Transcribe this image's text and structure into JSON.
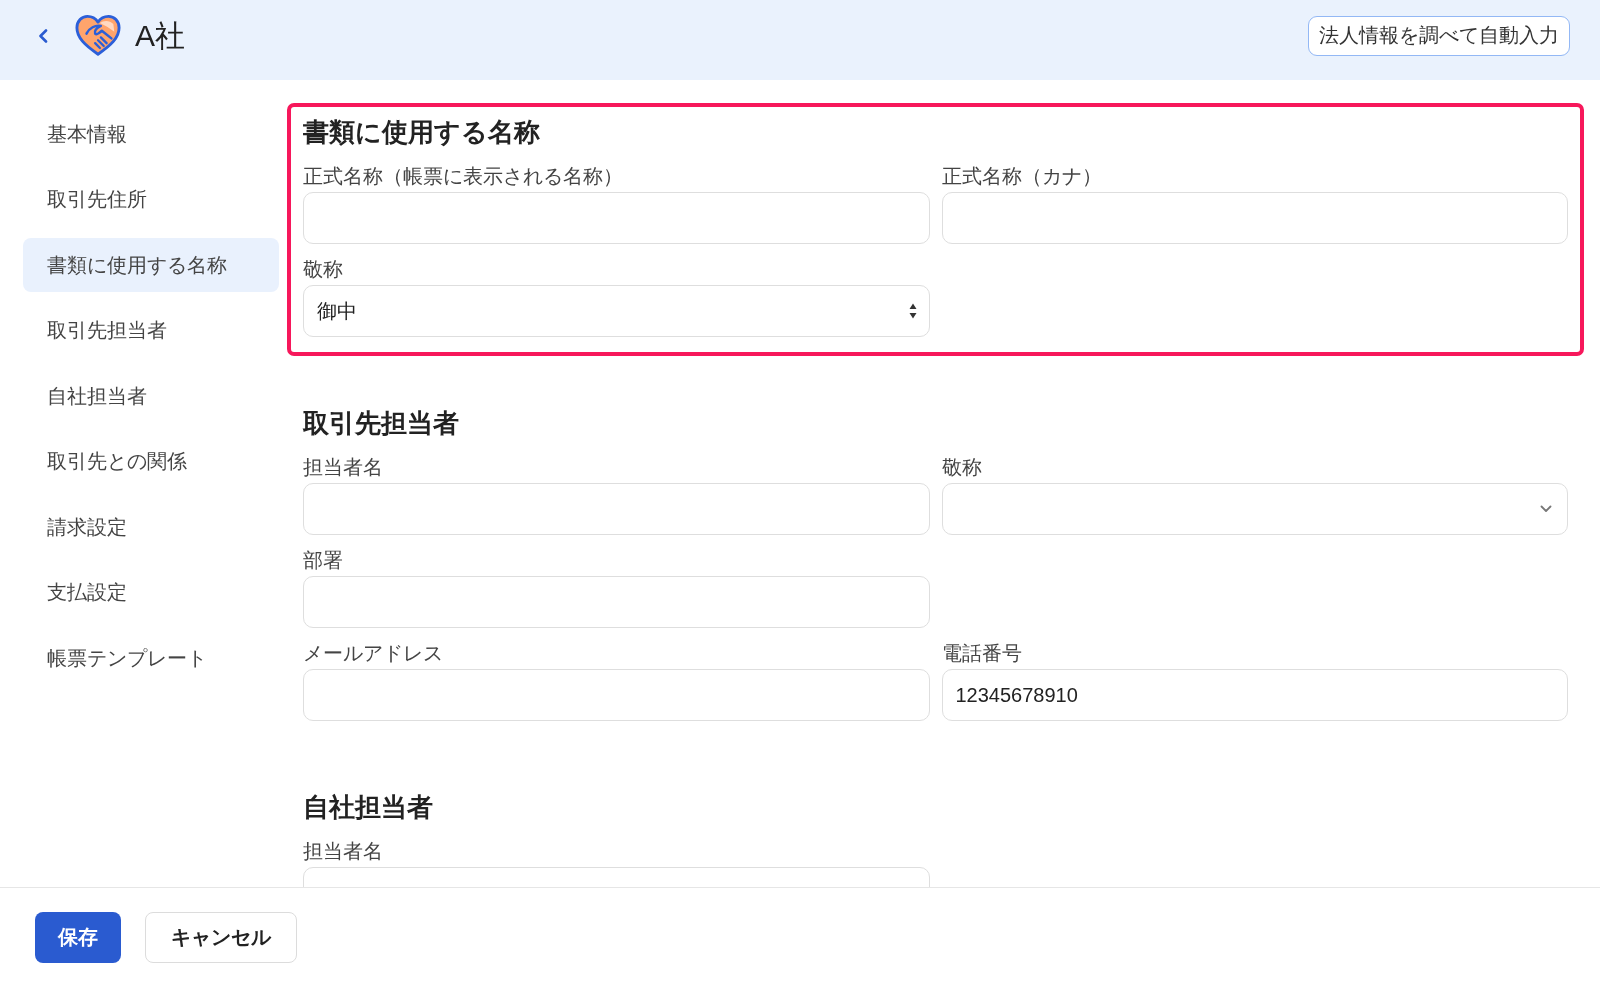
{
  "header": {
    "title": "A社",
    "autofill_button": "法人情報を調べて自動入力"
  },
  "sidebar": {
    "items": [
      {
        "label": "基本情報",
        "selected": false
      },
      {
        "label": "取引先住所",
        "selected": false
      },
      {
        "label": "書類に使用する名称",
        "selected": true
      },
      {
        "label": "取引先担当者",
        "selected": false
      },
      {
        "label": "自社担当者",
        "selected": false
      },
      {
        "label": "取引先との関係",
        "selected": false
      },
      {
        "label": "請求設定",
        "selected": false
      },
      {
        "label": "支払設定",
        "selected": false
      },
      {
        "label": "帳票テンプレート",
        "selected": false
      }
    ]
  },
  "sections": [
    {
      "title": "書類に使用する名称",
      "highlighted": true,
      "rows": [
        {
          "fields": [
            {
              "label": "正式名称（帳票に表示される名称）",
              "kind": "text"
            },
            {
              "label": "正式名称（カナ）",
              "kind": "text"
            }
          ]
        },
        {
          "fields": [
            {
              "label": "敬称",
              "kind": "select",
              "value": "御中"
            }
          ]
        }
      ]
    },
    {
      "title": "取引先担当者",
      "highlighted": false,
      "rows": [
        {
          "fields": [
            {
              "label": "担当者名",
              "kind": "text"
            },
            {
              "label": "敬称",
              "kind": "dropdown"
            }
          ]
        },
        {
          "fields": [
            {
              "label": "部署",
              "kind": "text"
            }
          ]
        },
        {
          "fields": [
            {
              "label": "メールアドレス",
              "kind": "text"
            },
            {
              "label": "電話番号",
              "kind": "text",
              "value": "12345678910"
            }
          ]
        }
      ]
    },
    {
      "title": "自社担当者",
      "highlighted": false,
      "rows": [
        {
          "fields": [
            {
              "label": "担当者名",
              "kind": "text"
            }
          ]
        }
      ]
    }
  ],
  "footer": {
    "buttons": [
      {
        "label": "保存",
        "kind": "primary"
      },
      {
        "label": "キャンセル",
        "kind": "secondary"
      }
    ]
  }
}
